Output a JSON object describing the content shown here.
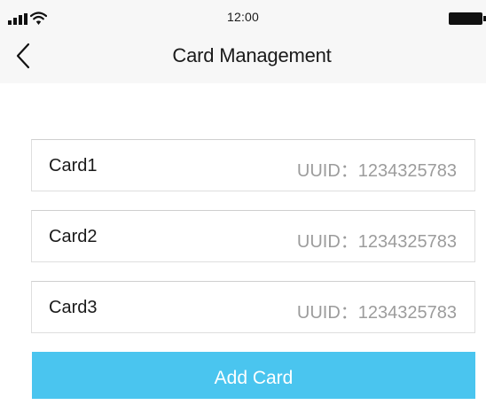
{
  "status_bar": {
    "time": "12:00",
    "icons": [
      "signal-icon",
      "wifi-icon",
      "battery-icon"
    ]
  },
  "nav": {
    "back_icon": "chevron-left-icon",
    "title": "Card Management"
  },
  "cards": [
    {
      "name": "Card1",
      "uuid": "UUID：1234325783"
    },
    {
      "name": "Card2",
      "uuid": "UUID：1234325783"
    },
    {
      "name": "Card3",
      "uuid": "UUID：1234325783"
    }
  ],
  "add_button": {
    "label": "Add Card"
  },
  "colors": {
    "accent": "#4ac5ef",
    "header_background": "#f7f7f7",
    "secondary_text": "#9c9c9c"
  }
}
